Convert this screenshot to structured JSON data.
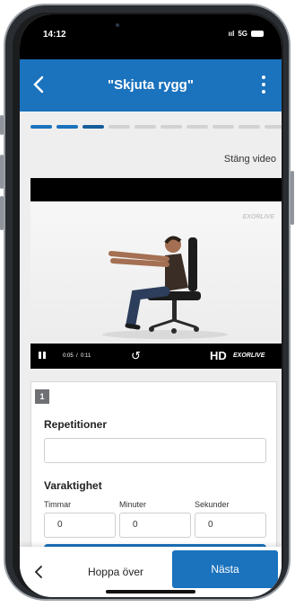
{
  "status_bar": {
    "time": "14:12",
    "signal": "ııl",
    "network": "5G"
  },
  "header": {
    "title": "\"Skjuta rygg\"",
    "back_icon": "chevron-left-icon",
    "menu_icon": "kebab-menu-icon",
    "bg_color": "#1b72bd"
  },
  "progress": {
    "total_steps": 10,
    "completed_steps": 2,
    "current_step": 3
  },
  "video": {
    "close_label": "Stäng video",
    "current_time": "0:05",
    "duration": "0:11",
    "separator": "/",
    "quality_label": "HD",
    "brand_logo": "EXORLIVE",
    "playing": true,
    "progress_fraction": 0.45
  },
  "form": {
    "set_number": "1",
    "repetitions_label": "Repetitioner",
    "repetitions_value": "",
    "duration_label": "Varaktighet",
    "hours_label": "Timmar",
    "minutes_label": "Minuter",
    "seconds_label": "Sekunder",
    "hours_value": "0",
    "minutes_value": "0",
    "seconds_value": "0"
  },
  "bottom": {
    "back_icon": "chevron-left-icon",
    "skip_label": "Hoppa över",
    "next_label": "Nästa"
  }
}
